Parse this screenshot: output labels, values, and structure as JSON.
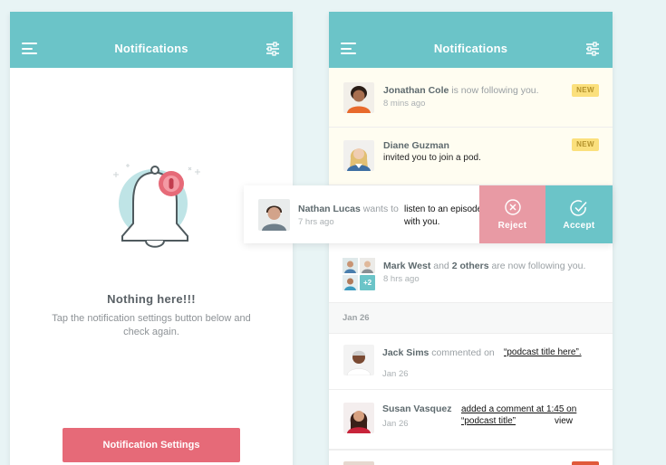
{
  "left_screen": {
    "title": "Notifications",
    "empty_title": "Nothing here!!!",
    "empty_text": "Tap the notification settings button below and check again.",
    "settings_button": "Notification Settings"
  },
  "right_screen": {
    "title": "Notifications",
    "notifications": [
      {
        "name": "Jonathan Cole",
        "text": " is now following you.",
        "time": "8 mins ago",
        "badge": "NEW"
      },
      {
        "name": "Diane Guzman",
        "text": "invited you to join a pod.",
        "badge": "NEW"
      },
      {
        "name": "Mark West",
        "and_word": " and ",
        "others": "2 others",
        "text": " are now following you.",
        "time": "8 hrs ago",
        "plus_count": "+2"
      }
    ],
    "swipe_card": {
      "name": "Nathan Lucas",
      "wants": " wants to",
      "message": "listen to an episode with you.",
      "time": "7 hrs ago",
      "reject_label": "Reject",
      "accept_label": "Accept"
    },
    "date_separator": "Jan 26",
    "older": [
      {
        "name": "Jack Sims",
        "text": " commented on",
        "link": "“podcast title here”.",
        "time": "Jan 26"
      },
      {
        "name": "Susan Vasquez",
        "link_line1": "added a comment at 1:45 on",
        "link_line2": "“podcast title”",
        "view": "view",
        "time": "Jan 26"
      }
    ]
  },
  "colors": {
    "teal": "#6bc4c8",
    "pink": "#e66a78",
    "new_badge": "#fbe07d"
  }
}
